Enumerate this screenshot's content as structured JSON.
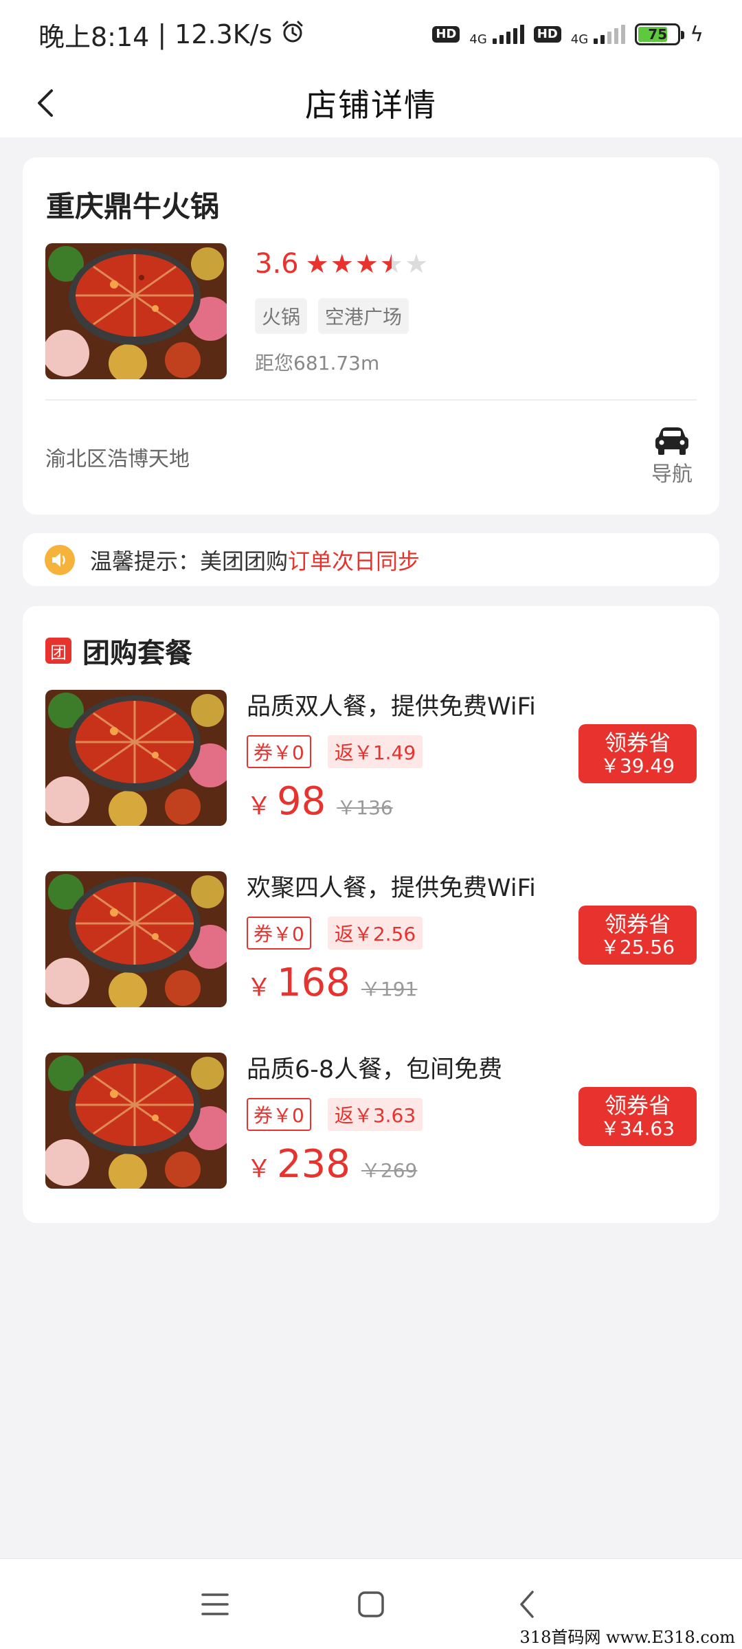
{
  "status_bar": {
    "time": "晚上8:14",
    "speed": "12.3K/s",
    "hd1": "HD",
    "net1": "4G",
    "hd2": "HD",
    "net2": "4G",
    "battery": "75"
  },
  "header": {
    "title": "店铺详情"
  },
  "store": {
    "name": "重庆鼎牛火锅",
    "rating": "3.6",
    "rating_value": 3.6,
    "tags": [
      "火锅",
      "空港广场"
    ],
    "distance": "距您681.73m",
    "address": "渝北区浩博天地",
    "nav_label": "导航"
  },
  "notice": {
    "prefix": "温馨提示：美团团购",
    "highlight": "订单次日同步"
  },
  "group_buy": {
    "badge": "团",
    "title": "团购套餐",
    "deals": [
      {
        "name": "品质双人餐，提供免费WiFi",
        "coupon": "券￥0",
        "rebate": "返￥1.49",
        "price_symbol": "￥",
        "price": "98",
        "original_price": "￥136",
        "button_label": "领券省",
        "button_amount": "￥39.49"
      },
      {
        "name": "欢聚四人餐，提供免费WiFi",
        "coupon": "券￥0",
        "rebate": "返￥2.56",
        "price_symbol": "￥",
        "price": "168",
        "original_price": "￥191",
        "button_label": "领券省",
        "button_amount": "￥25.56"
      },
      {
        "name": "品质6-8人餐，包间免费",
        "coupon": "券￥0",
        "rebate": "返￥3.63",
        "price_symbol": "￥",
        "price": "238",
        "original_price": "￥269",
        "button_label": "领券省",
        "button_amount": "￥34.63"
      }
    ]
  },
  "watermark": "318首码网 www.E318.com",
  "colors": {
    "accent": "#e8322d",
    "background": "#f3f3f5",
    "notice_icon": "#f6b33b"
  }
}
